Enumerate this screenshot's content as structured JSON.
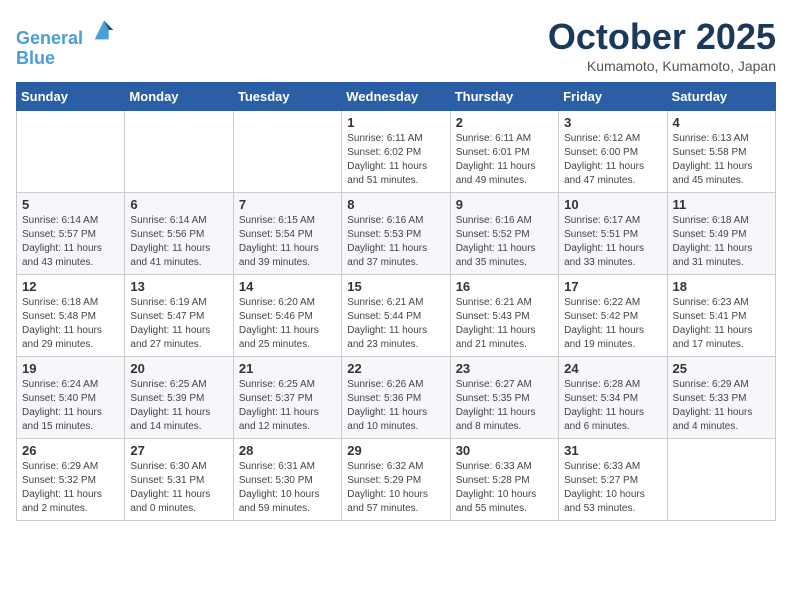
{
  "header": {
    "logo_line1": "General",
    "logo_line2": "Blue",
    "month": "October 2025",
    "location": "Kumamoto, Kumamoto, Japan"
  },
  "weekdays": [
    "Sunday",
    "Monday",
    "Tuesday",
    "Wednesday",
    "Thursday",
    "Friday",
    "Saturday"
  ],
  "weeks": [
    [
      {
        "day": "",
        "info": ""
      },
      {
        "day": "",
        "info": ""
      },
      {
        "day": "",
        "info": ""
      },
      {
        "day": "1",
        "info": "Sunrise: 6:11 AM\nSunset: 6:02 PM\nDaylight: 11 hours\nand 51 minutes."
      },
      {
        "day": "2",
        "info": "Sunrise: 6:11 AM\nSunset: 6:01 PM\nDaylight: 11 hours\nand 49 minutes."
      },
      {
        "day": "3",
        "info": "Sunrise: 6:12 AM\nSunset: 6:00 PM\nDaylight: 11 hours\nand 47 minutes."
      },
      {
        "day": "4",
        "info": "Sunrise: 6:13 AM\nSunset: 5:58 PM\nDaylight: 11 hours\nand 45 minutes."
      }
    ],
    [
      {
        "day": "5",
        "info": "Sunrise: 6:14 AM\nSunset: 5:57 PM\nDaylight: 11 hours\nand 43 minutes."
      },
      {
        "day": "6",
        "info": "Sunrise: 6:14 AM\nSunset: 5:56 PM\nDaylight: 11 hours\nand 41 minutes."
      },
      {
        "day": "7",
        "info": "Sunrise: 6:15 AM\nSunset: 5:54 PM\nDaylight: 11 hours\nand 39 minutes."
      },
      {
        "day": "8",
        "info": "Sunrise: 6:16 AM\nSunset: 5:53 PM\nDaylight: 11 hours\nand 37 minutes."
      },
      {
        "day": "9",
        "info": "Sunrise: 6:16 AM\nSunset: 5:52 PM\nDaylight: 11 hours\nand 35 minutes."
      },
      {
        "day": "10",
        "info": "Sunrise: 6:17 AM\nSunset: 5:51 PM\nDaylight: 11 hours\nand 33 minutes."
      },
      {
        "day": "11",
        "info": "Sunrise: 6:18 AM\nSunset: 5:49 PM\nDaylight: 11 hours\nand 31 minutes."
      }
    ],
    [
      {
        "day": "12",
        "info": "Sunrise: 6:18 AM\nSunset: 5:48 PM\nDaylight: 11 hours\nand 29 minutes."
      },
      {
        "day": "13",
        "info": "Sunrise: 6:19 AM\nSunset: 5:47 PM\nDaylight: 11 hours\nand 27 minutes."
      },
      {
        "day": "14",
        "info": "Sunrise: 6:20 AM\nSunset: 5:46 PM\nDaylight: 11 hours\nand 25 minutes."
      },
      {
        "day": "15",
        "info": "Sunrise: 6:21 AM\nSunset: 5:44 PM\nDaylight: 11 hours\nand 23 minutes."
      },
      {
        "day": "16",
        "info": "Sunrise: 6:21 AM\nSunset: 5:43 PM\nDaylight: 11 hours\nand 21 minutes."
      },
      {
        "day": "17",
        "info": "Sunrise: 6:22 AM\nSunset: 5:42 PM\nDaylight: 11 hours\nand 19 minutes."
      },
      {
        "day": "18",
        "info": "Sunrise: 6:23 AM\nSunset: 5:41 PM\nDaylight: 11 hours\nand 17 minutes."
      }
    ],
    [
      {
        "day": "19",
        "info": "Sunrise: 6:24 AM\nSunset: 5:40 PM\nDaylight: 11 hours\nand 15 minutes."
      },
      {
        "day": "20",
        "info": "Sunrise: 6:25 AM\nSunset: 5:39 PM\nDaylight: 11 hours\nand 14 minutes."
      },
      {
        "day": "21",
        "info": "Sunrise: 6:25 AM\nSunset: 5:37 PM\nDaylight: 11 hours\nand 12 minutes."
      },
      {
        "day": "22",
        "info": "Sunrise: 6:26 AM\nSunset: 5:36 PM\nDaylight: 11 hours\nand 10 minutes."
      },
      {
        "day": "23",
        "info": "Sunrise: 6:27 AM\nSunset: 5:35 PM\nDaylight: 11 hours\nand 8 minutes."
      },
      {
        "day": "24",
        "info": "Sunrise: 6:28 AM\nSunset: 5:34 PM\nDaylight: 11 hours\nand 6 minutes."
      },
      {
        "day": "25",
        "info": "Sunrise: 6:29 AM\nSunset: 5:33 PM\nDaylight: 11 hours\nand 4 minutes."
      }
    ],
    [
      {
        "day": "26",
        "info": "Sunrise: 6:29 AM\nSunset: 5:32 PM\nDaylight: 11 hours\nand 2 minutes."
      },
      {
        "day": "27",
        "info": "Sunrise: 6:30 AM\nSunset: 5:31 PM\nDaylight: 11 hours\nand 0 minutes."
      },
      {
        "day": "28",
        "info": "Sunrise: 6:31 AM\nSunset: 5:30 PM\nDaylight: 10 hours\nand 59 minutes."
      },
      {
        "day": "29",
        "info": "Sunrise: 6:32 AM\nSunset: 5:29 PM\nDaylight: 10 hours\nand 57 minutes."
      },
      {
        "day": "30",
        "info": "Sunrise: 6:33 AM\nSunset: 5:28 PM\nDaylight: 10 hours\nand 55 minutes."
      },
      {
        "day": "31",
        "info": "Sunrise: 6:33 AM\nSunset: 5:27 PM\nDaylight: 10 hours\nand 53 minutes."
      },
      {
        "day": "",
        "info": ""
      }
    ]
  ]
}
